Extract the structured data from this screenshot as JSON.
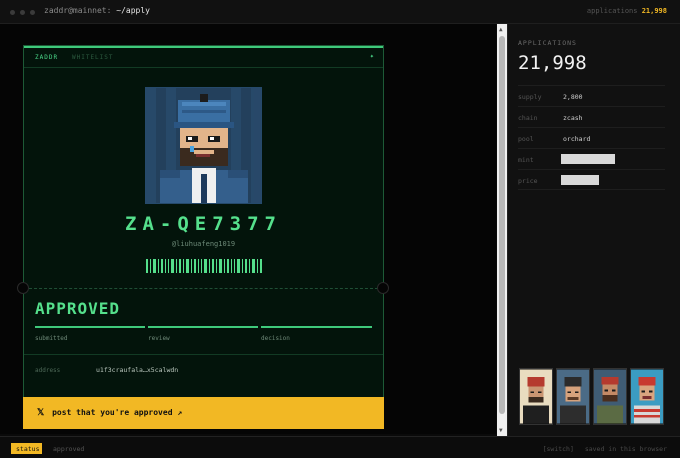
{
  "titlebar": {
    "host": "zaddr@mainnet",
    "path": "~/apply",
    "apps_label": "applications",
    "apps_count": "21,998"
  },
  "card": {
    "tab_active": "ZADDR",
    "tab_inactive": "WHITELIST",
    "star": "✦",
    "handle_id": "ZA-QE7377",
    "handle_twitter": "@liuhuafeng1019",
    "status": "APPROVED",
    "steps": [
      "submitted",
      "review",
      "decision"
    ],
    "address_label": "address",
    "address_value": "u1f3craufala…x5calwdn"
  },
  "cta": {
    "icon": "𝕏",
    "label": "post that you're approved",
    "arrow": "↗"
  },
  "side": {
    "label": "APPLICATIONS",
    "count": "21,998",
    "rows": [
      {
        "key": "supply",
        "value": "2,800"
      },
      {
        "key": "chain",
        "value": "zcash"
      },
      {
        "key": "pool",
        "value": "orchard"
      },
      {
        "key": "mint",
        "value": ""
      },
      {
        "key": "price",
        "value": ""
      }
    ]
  },
  "statusbar": {
    "tag": "status",
    "value": "approved",
    "switch": "[switch]",
    "saved": "saved in this browser"
  },
  "colors": {
    "accent_green": "#55e08c",
    "accent_yellow": "#f2b824",
    "card_bg": "#03140b"
  }
}
